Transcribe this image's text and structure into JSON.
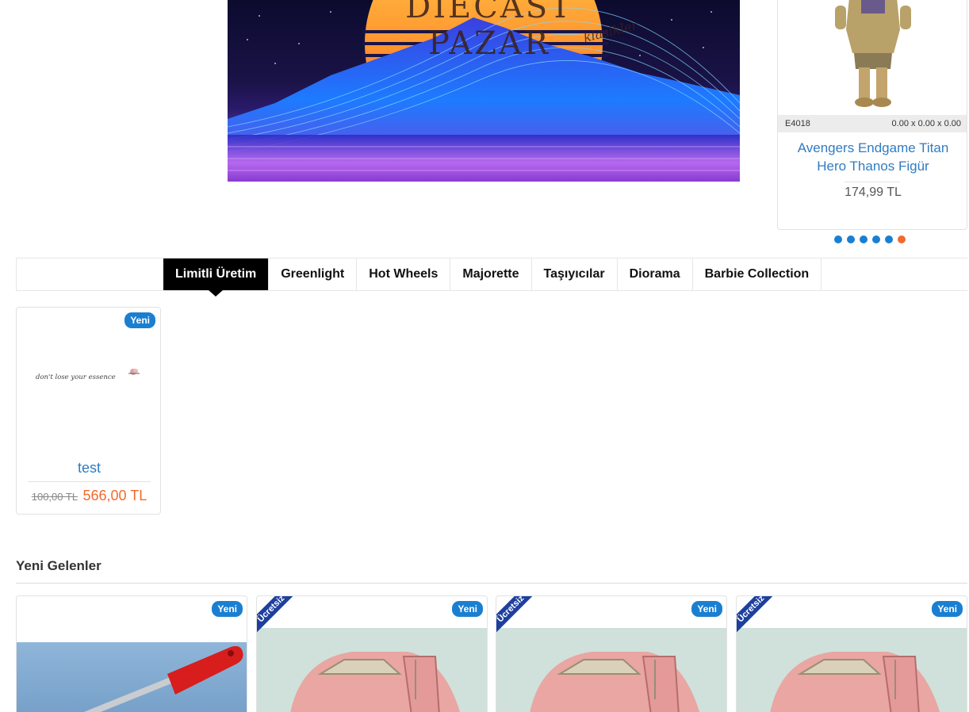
{
  "banner": {
    "title": "DIECAST PAZAR",
    "subtitle": "klasikler"
  },
  "featured": {
    "code": "E4018",
    "dimensions": "0.00 x 0.00 x 0.00",
    "name": "Avengers Endgame Titan Hero Thanos Figür",
    "price": "174,99 TL",
    "slides_total": 6,
    "active_slide": 6
  },
  "tabs": [
    {
      "label": "Limitli Üretim",
      "active": true
    },
    {
      "label": "Greenlight"
    },
    {
      "label": "Hot Wheels"
    },
    {
      "label": "Majorette"
    },
    {
      "label": "Taşıyıcılar"
    },
    {
      "label": "Diorama"
    },
    {
      "label": "Barbie Collection"
    }
  ],
  "product": {
    "badge": "Yeni",
    "image_text": "don't lose your essence",
    "name": "test",
    "old_price": "100,00 TL",
    "new_price": "566,00 TL"
  },
  "new_arrivals": {
    "title": "Yeni Gelenler",
    "cards": [
      {
        "badge": "Yeni",
        "ribbon": "",
        "image": "screwdriver"
      },
      {
        "badge": "Yeni",
        "ribbon": "Ücretsiz",
        "image": "pink-car"
      },
      {
        "badge": "Yeni",
        "ribbon": "Ücretsiz",
        "image": "pink-car"
      },
      {
        "badge": "Yeni",
        "ribbon": "Ücretsiz",
        "image": "pink-car"
      }
    ]
  },
  "colors": {
    "accent_blue": "#1a7fd1",
    "link_blue": "#2f7cc2",
    "price_orange": "#f26a2e",
    "ribbon_navy": "#1d3f9e"
  }
}
